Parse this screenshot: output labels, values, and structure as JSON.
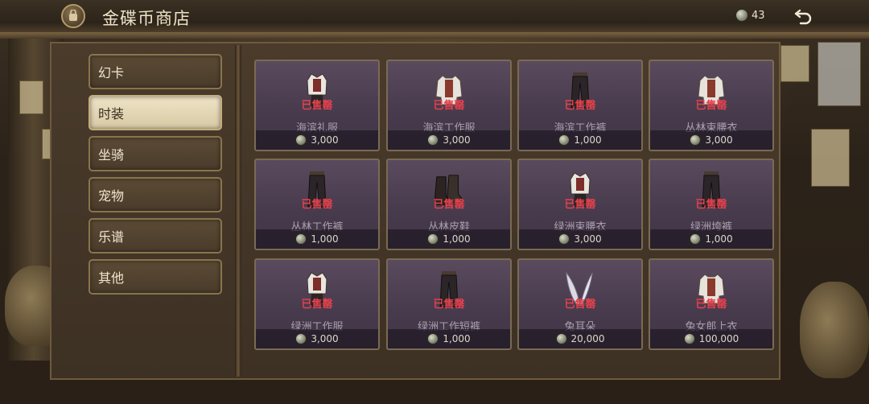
{
  "header": {
    "title": "金碟币商店",
    "coins": "43"
  },
  "tabs": [
    {
      "label": "幻卡",
      "active": false
    },
    {
      "label": "时装",
      "active": true
    },
    {
      "label": "坐骑",
      "active": false
    },
    {
      "label": "宠物",
      "active": false
    },
    {
      "label": "乐谱",
      "active": false
    },
    {
      "label": "其他",
      "active": false
    }
  ],
  "items": [
    {
      "name": "海滨礼服",
      "status": "已售罄",
      "price": "3,000",
      "icon": "outfit-icon"
    },
    {
      "name": "海滨工作服",
      "status": "已售罄",
      "price": "3,000",
      "icon": "shirt-icon"
    },
    {
      "name": "海滨工作裤",
      "status": "已售罄",
      "price": "1,000",
      "icon": "pants-icon"
    },
    {
      "name": "丛林束腰衣",
      "status": "已售罄",
      "price": "3,000",
      "icon": "shirt-icon"
    },
    {
      "name": "丛林工作裤",
      "status": "已售罄",
      "price": "1,000",
      "icon": "pants-icon"
    },
    {
      "name": "丛林皮鞋",
      "status": "已售罄",
      "price": "1,000",
      "icon": "boots-icon"
    },
    {
      "name": "绿洲束腰衣",
      "status": "已售罄",
      "price": "3,000",
      "icon": "outfit-icon"
    },
    {
      "name": "绿洲垮裤",
      "status": "已售罄",
      "price": "1,000",
      "icon": "pants-icon"
    },
    {
      "name": "绿洲工作服",
      "status": "已售罄",
      "price": "3,000",
      "icon": "outfit-icon"
    },
    {
      "name": "绿洲工作短裤",
      "status": "已售罄",
      "price": "1,000",
      "icon": "pants-icon"
    },
    {
      "name": "兔耳朵",
      "status": "已售罄",
      "price": "20,000",
      "icon": "bunny-ears-icon"
    },
    {
      "name": "兔女郎上衣",
      "status": "已售罄",
      "price": "100,000",
      "icon": "shirt-icon"
    }
  ]
}
